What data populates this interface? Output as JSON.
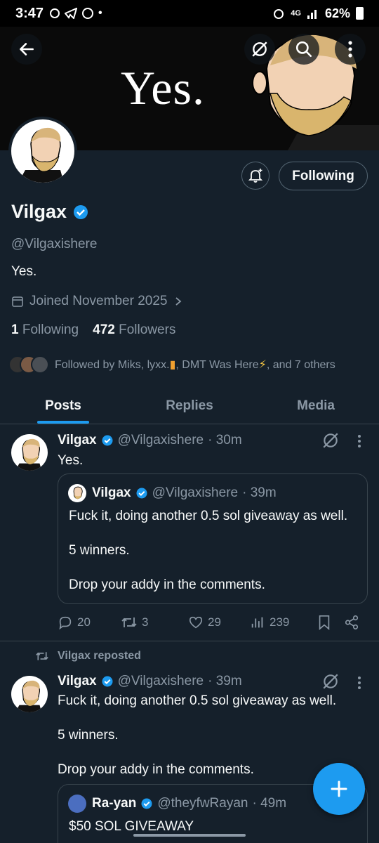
{
  "status": {
    "time": "3:47",
    "network": "4G",
    "battery": "62%"
  },
  "banner": {
    "headline": "Yes."
  },
  "profile": {
    "name": "Vilgax",
    "handle": "@Vilgaxishere",
    "bio": "Yes.",
    "joined": "Joined November 2025",
    "following_count": "1",
    "following_label": "Following",
    "followers_count": "472",
    "followers_label": "Followers",
    "followed_by": "Followed by Miks, lyxx.",
    "followed_by_2": ", DMT Was Here",
    "followed_by_3": ", and 7 others",
    "follow_button": "Following"
  },
  "tabs": [
    "Posts",
    "Replies",
    "Media"
  ],
  "posts": [
    {
      "name": "Vilgax",
      "handle": "@Vilgaxishere",
      "time": "· 30m",
      "text": "Yes.",
      "quote": {
        "name": "Vilgax",
        "handle": "@Vilgaxishere",
        "time": "· 39m",
        "line1": "Fuck it, doing another 0.5 sol giveaway as well.",
        "line2": "5 winners.",
        "line3": "Drop your addy in the comments."
      },
      "replies": "20",
      "reposts": "3",
      "likes": "29",
      "views": "239"
    },
    {
      "repost_label": "Vilgax reposted",
      "name": "Vilgax",
      "handle": "@Vilgaxishere",
      "time": "· 39m",
      "line1": "Fuck it, doing another 0.5 sol giveaway as well.",
      "line2": "5 winners.",
      "line3": "Drop your addy in the comments.",
      "quote": {
        "name": "Ra-yan",
        "handle": "@theyfwRayan",
        "time": "· 49m",
        "line1": "$50 SOL GIVEAWAY"
      }
    }
  ],
  "colors": {
    "accent": "#1d9bf0",
    "bg": "#15202b",
    "muted": "#8b98a5"
  }
}
